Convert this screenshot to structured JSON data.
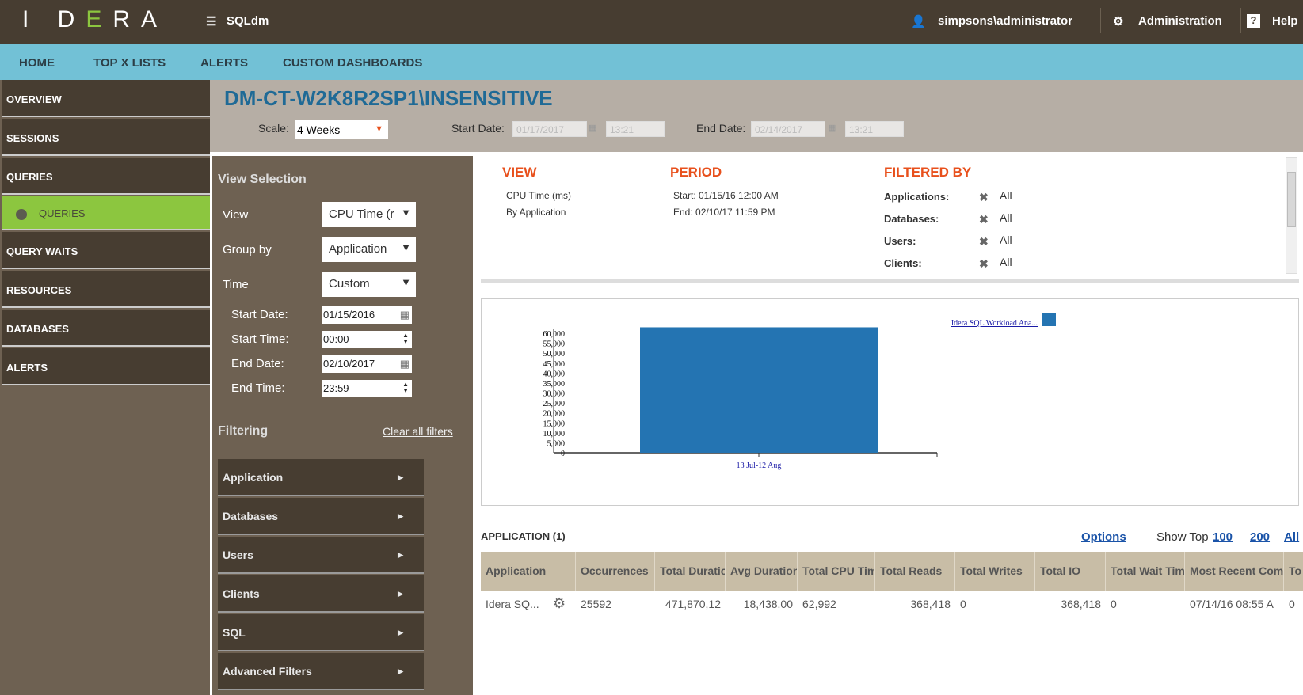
{
  "header": {
    "logo": "IDERA",
    "product": "SQLdm",
    "user": "simpsons\\administrator",
    "admin": "Administration",
    "help": "Help"
  },
  "nav": [
    "HOME",
    "TOP X LISTS",
    "ALERTS",
    "CUSTOM DASHBOARDS"
  ],
  "sidebar": {
    "items": [
      "OVERVIEW",
      "SESSIONS",
      "QUERIES",
      "QUERIES",
      "QUERY WAITS",
      "RESOURCES",
      "DATABASES",
      "ALERTS"
    ]
  },
  "titlebar": {
    "title": "DM-CT-W2K8R2SP1\\INSENSITIVE",
    "scale_label": "Scale:",
    "scale": "4 Weeks",
    "start_label": "Start Date:",
    "start_date": "01/17/2017",
    "start_time": "13:21",
    "end_label": "End Date:",
    "end_date": "02/14/2017",
    "end_time": "13:21"
  },
  "view_selection": {
    "title": "View Selection",
    "view_label": "View",
    "view": "CPU Time (r",
    "group_label": "Group by",
    "group": "Application",
    "time_label": "Time",
    "time": "Custom",
    "start_date_label": "Start Date:",
    "start_date": "01/15/2016",
    "start_time_label": "Start Time:",
    "start_time": "00:00",
    "end_date_label": "End Date:",
    "end_date": "02/10/2017",
    "end_time_label": "End Time:",
    "end_time": "23:59"
  },
  "filtering": {
    "title": "Filtering",
    "clear": "Clear all filters",
    "items": [
      "Application",
      "Databases",
      "Users",
      "Clients",
      "SQL",
      "Advanced Filters"
    ]
  },
  "summary": {
    "view_h": "VIEW",
    "view1": "CPU Time (ms)",
    "view2": "By Application",
    "period_h": "PERIOD",
    "period1": "Start: 01/15/16 12:00 AM",
    "period2": "End: 02/10/17 11:59 PM",
    "filtered_h": "FILTERED BY",
    "filters": [
      {
        "label": "Applications:",
        "value": "All"
      },
      {
        "label": "Databases:",
        "value": "All"
      },
      {
        "label": "Users:",
        "value": "All"
      },
      {
        "label": "Clients:",
        "value": "All"
      }
    ]
  },
  "chart_data": {
    "type": "bar",
    "categories": [
      "13 Jul-12 Aug"
    ],
    "series": [
      {
        "name": "Idera SQL Workload Ana...",
        "values": [
          62992
        ],
        "color": "#2474b2"
      }
    ],
    "ylim": [
      0,
      60000
    ],
    "yticks": [
      "60,000",
      "55,000",
      "50,000",
      "45,000",
      "40,000",
      "35,000",
      "30,000",
      "25,000",
      "20,000",
      "15,000",
      "10,000",
      "5,000",
      "0"
    ],
    "legend": "top-right"
  },
  "table": {
    "title": "APPLICATION (1)",
    "options": "Options",
    "show_top": "Show Top",
    "top_opts": [
      "100",
      "200",
      "All"
    ],
    "columns": [
      "Application",
      "Occurrences",
      "Total Duration (ı",
      "Avg Duration (ı",
      "Total CPU Time (ms)",
      "Total Reads",
      "Total Writes",
      "Total IO",
      "Total Wait Time (ms)",
      "Most Recent Completion",
      "To Ti"
    ],
    "rows": [
      [
        "Idera SQ...",
        "25592",
        "471,870,12",
        "18,438.00",
        "62,992",
        "368,418",
        "0",
        "368,418",
        "0",
        "07/14/16 08:55 A",
        "0"
      ]
    ]
  }
}
